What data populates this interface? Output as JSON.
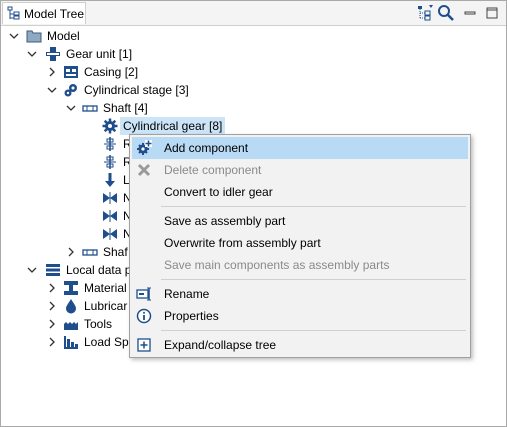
{
  "tab": {
    "title": "Model Tree"
  },
  "tree": {
    "model": "Model",
    "gear_unit": "Gear unit [1]",
    "casing": "Casing [2]",
    "cyl_stage": "Cylindrical stage [3]",
    "shaft4": "Shaft [4]",
    "cyl_gear": "Cylindrical gear [8]",
    "r1": "R",
    "r2": "R",
    "l": "L",
    "n1": "N",
    "n2": "N",
    "n3": "N",
    "shaft2": "Shaf",
    "local_data": "Local data p",
    "materials": "Material",
    "lubricants": "Lubricar",
    "tools": "Tools",
    "load_spectra": "Load Sp"
  },
  "menu": {
    "add_component": "Add component",
    "delete_component": "Delete component",
    "convert_idler": "Convert to idler gear",
    "save_assembly": "Save as assembly part",
    "overwrite_assembly": "Overwrite from assembly part",
    "save_main": "Save main components as assembly parts",
    "rename": "Rename",
    "properties": "Properties",
    "expand_collapse": "Expand/collapse tree"
  },
  "colors": {
    "selection": "#cce4f7",
    "menu_highlight": "#b9daf5",
    "icon_blue": "#1f4e8c",
    "disabled_text": "#8a8a8a"
  }
}
